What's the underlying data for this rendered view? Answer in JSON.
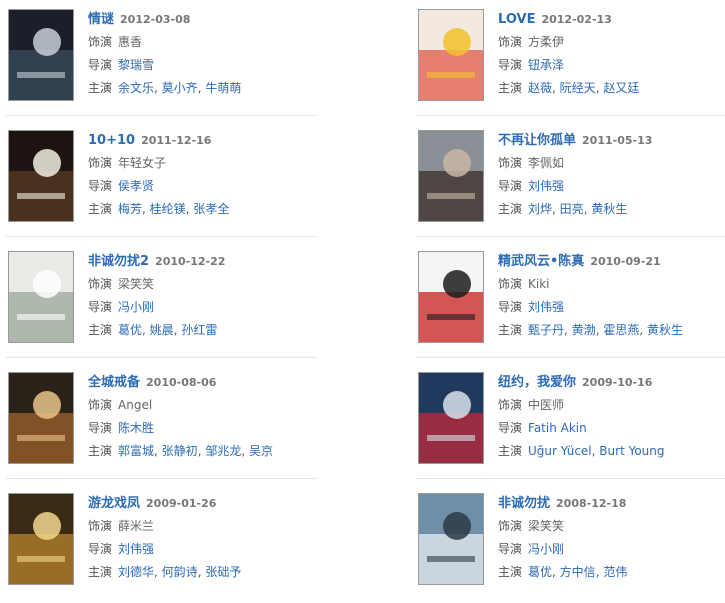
{
  "films": [
    {
      "title": "情谜",
      "date": "2012-03-08",
      "role_label": "饰演",
      "role": "惠香",
      "director_label": "导演",
      "director": "黎瑞雪",
      "cast_label": "主演",
      "cast": [
        "余文乐",
        "莫小齐",
        "牛萌萌"
      ],
      "colors": [
        "#1a1f2a",
        "#3a4e5e",
        "#c9cfd6"
      ]
    },
    {
      "title": "LOVE",
      "date": "2012-02-13",
      "role_label": "饰演",
      "role": "方柔伊",
      "director_label": "导演",
      "director": "钮承泽",
      "cast_label": "主演",
      "cast": [
        "赵薇",
        "阮经天",
        "赵又廷"
      ],
      "colors": [
        "#f4e9e0",
        "#e15b4a",
        "#f1c22e"
      ]
    },
    {
      "title": "10+10",
      "date": "2011-12-16",
      "role_label": "饰演",
      "role": "年轻女子",
      "director_label": "导演",
      "director": "侯孝贤",
      "cast_label": "主演",
      "cast": [
        "梅芳",
        "桂纶镁",
        "张孝全"
      ],
      "colors": [
        "#1b1410",
        "#5b3b22",
        "#f2ede2"
      ]
    },
    {
      "title": "不再让你孤单",
      "date": "2011-05-13",
      "role_label": "饰演",
      "role": "李佩如",
      "director_label": "导演",
      "director": "刘伟强",
      "cast_label": "主演",
      "cast": [
        "刘烨",
        "田亮",
        "黄秋生"
      ],
      "colors": [
        "#8a8f95",
        "#3a2e2b",
        "#c7b7a4"
      ]
    },
    {
      "title": "非诚勿扰2",
      "date": "2010-12-22",
      "role_label": "饰演",
      "role": "梁笑笑",
      "director_label": "导演",
      "director": "冯小刚",
      "cast_label": "主演",
      "cast": [
        "葛优",
        "姚晨",
        "孙红雷"
      ],
      "colors": [
        "#e9ece6",
        "#9aa79a",
        "#ffffff"
      ]
    },
    {
      "title": "精武风云•陈真",
      "date": "2010-09-21",
      "role_label": "饰演",
      "role": "Kiki",
      "director_label": "导演",
      "director": "刘伟强",
      "cast_label": "主演",
      "cast": [
        "甄子丹",
        "黄渤",
        "霍思燕",
        "黄秋生"
      ],
      "colors": [
        "#f5f5f5",
        "#c8201e",
        "#1c1c1c"
      ]
    },
    {
      "title": "全城戒备",
      "date": "2010-08-06",
      "role_label": "饰演",
      "role": "Angel",
      "director_label": "导演",
      "director": "陈木胜",
      "cast_label": "主演",
      "cast": [
        "郭富城",
        "张静初",
        "邹兆龙",
        "吴京"
      ],
      "colors": [
        "#2a2118",
        "#a0622a",
        "#e7c48a"
      ]
    },
    {
      "title": "纽约，我爱你",
      "date": "2009-10-16",
      "role_label": "饰演",
      "role": "中医师",
      "director_label": "导演",
      "director": "Fatih Akin",
      "cast_label": "主演",
      "cast": [
        "Uğur Yücel",
        "Burt Young"
      ],
      "colors": [
        "#1f3a5c",
        "#c0293b",
        "#d8e2ea"
      ]
    },
    {
      "title": "游龙戏凤",
      "date": "2009-01-26",
      "role_label": "饰演",
      "role": "薛米兰",
      "director_label": "导演",
      "director": "刘伟强",
      "cast_label": "主演",
      "cast": [
        "刘德华",
        "何韵诗",
        "张础予"
      ],
      "colors": [
        "#3b2a14",
        "#b8842c",
        "#f2d78f"
      ]
    },
    {
      "title": "非诚勿扰",
      "date": "2008-12-18",
      "role_label": "饰演",
      "role": "梁笑笑",
      "director_label": "导演",
      "director": "冯小刚",
      "cast_label": "主演",
      "cast": [
        "葛优",
        "方中信",
        "范伟"
      ],
      "colors": [
        "#6f8fa8",
        "#e7eef2",
        "#2b3a46"
      ]
    }
  ]
}
